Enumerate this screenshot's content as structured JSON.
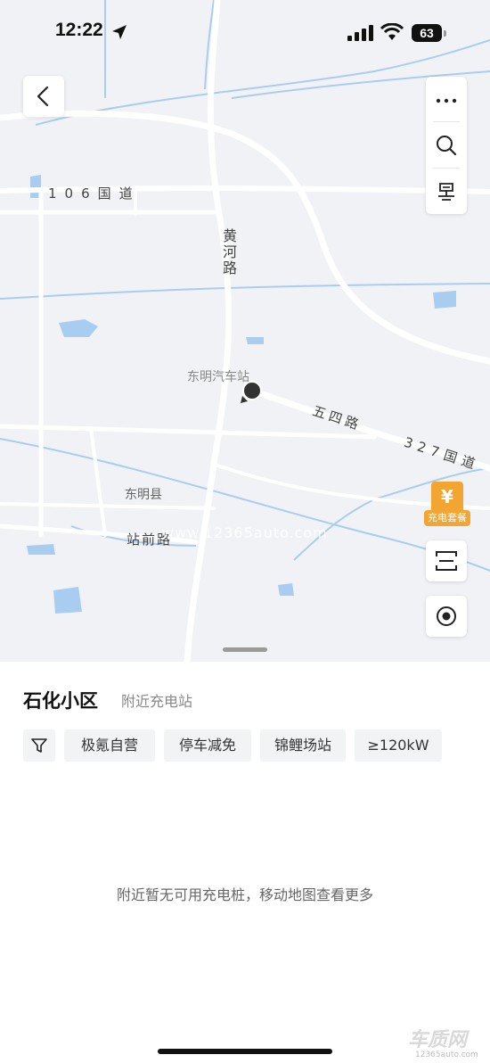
{
  "status_bar": {
    "time": "12:22",
    "battery": "63"
  },
  "map": {
    "road_labels": {
      "national_106": "106国道",
      "huanghe": "黄河路",
      "wusi": "五四路",
      "national_327": "327国道",
      "zhanqian": "站前路"
    },
    "place_labels": {
      "county": "东明县",
      "bus_station": "东明汽车站"
    },
    "watermark": "www.12365auto.com",
    "package_badge": {
      "symbol": "¥",
      "label": "充电套餐"
    }
  },
  "sheet": {
    "title": "石化小区",
    "subtitle": "附近充电站",
    "filters": [
      "极氪自营",
      "停车减免",
      "锦鲤场站",
      "≥120kW"
    ],
    "empty_message": "附近暂无可用充电桩，移动地图查看更多"
  },
  "corner_watermark": {
    "logo": "车质网",
    "url": "12365auto.com"
  },
  "icons": {
    "back": "chevron-left-icon",
    "more": "more-icon",
    "search": "search-icon",
    "route": "route-icon",
    "scan": "scan-icon",
    "locate": "locate-icon",
    "filter": "filter-icon"
  },
  "colors": {
    "map_bg": "#f1f2f5",
    "water": "#a9cdf0",
    "accent": "#f2a531"
  }
}
